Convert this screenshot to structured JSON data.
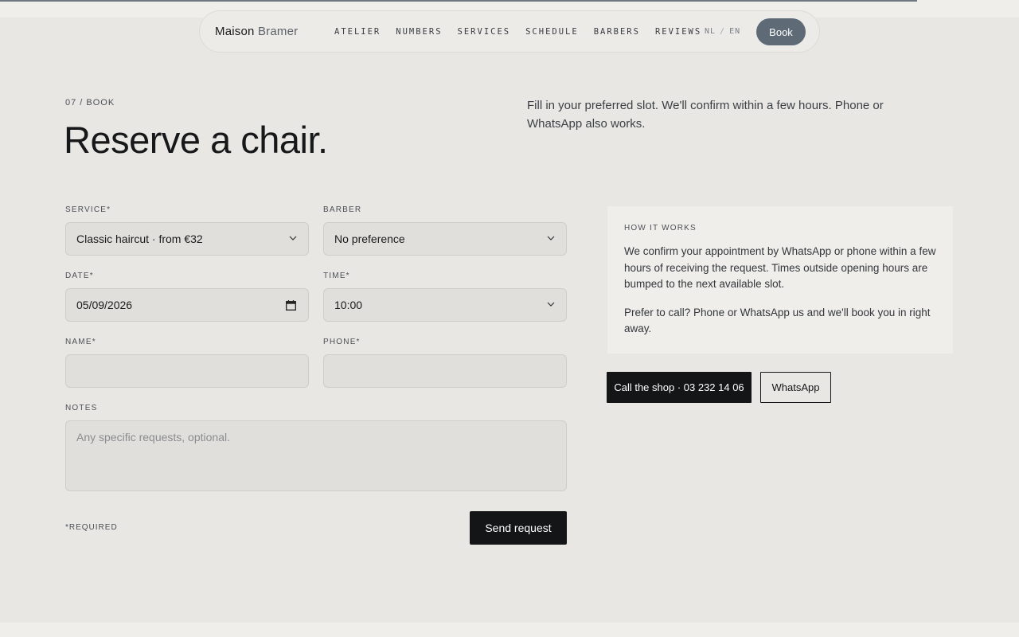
{
  "scroll_progress": 0.9,
  "colors": {
    "background": "#e8e7e4",
    "accent_button": "#5e6a75",
    "primary_button": "#141516"
  },
  "nav": {
    "brand_first": "Maison",
    "brand_second": "Bramer",
    "links": [
      "ATELIER",
      "NUMBERS",
      "SERVICES",
      "SCHEDULE",
      "BARBERS",
      "REVIEWS"
    ],
    "lang_nl": "NL",
    "lang_sep": "/",
    "lang_en": "EN",
    "book_label": "Book"
  },
  "header": {
    "eyebrow": "07 / BOOK",
    "title": "Reserve a chair.",
    "intro": "Fill in your preferred slot. We'll confirm within a few hours. Phone or WhatsApp also works."
  },
  "form": {
    "service": {
      "label": "SERVICE*",
      "value": "Classic haircut · from €32"
    },
    "barber": {
      "label": "BARBER",
      "value": "No preference"
    },
    "date": {
      "label": "DATE*",
      "value": "05/09/2026"
    },
    "time": {
      "label": "TIME*",
      "value": "10:00"
    },
    "name": {
      "label": "NAME*",
      "value": ""
    },
    "phone": {
      "label": "PHONE*",
      "value": ""
    },
    "notes": {
      "label": "NOTES",
      "placeholder": "Any specific requests, optional."
    },
    "required_note": "*REQUIRED",
    "submit_label": "Send request"
  },
  "info": {
    "eyebrow": "HOW IT WORKS",
    "paragraph1": "We confirm your appointment by WhatsApp or phone within a few hours of receiving the request. Times outside opening hours are bumped to the next available slot.",
    "paragraph2": "Prefer to call? Phone or WhatsApp us and we'll book you in right away.",
    "call_label": "Call the shop · 03 232 14 06",
    "whatsapp_label": "WhatsApp"
  }
}
